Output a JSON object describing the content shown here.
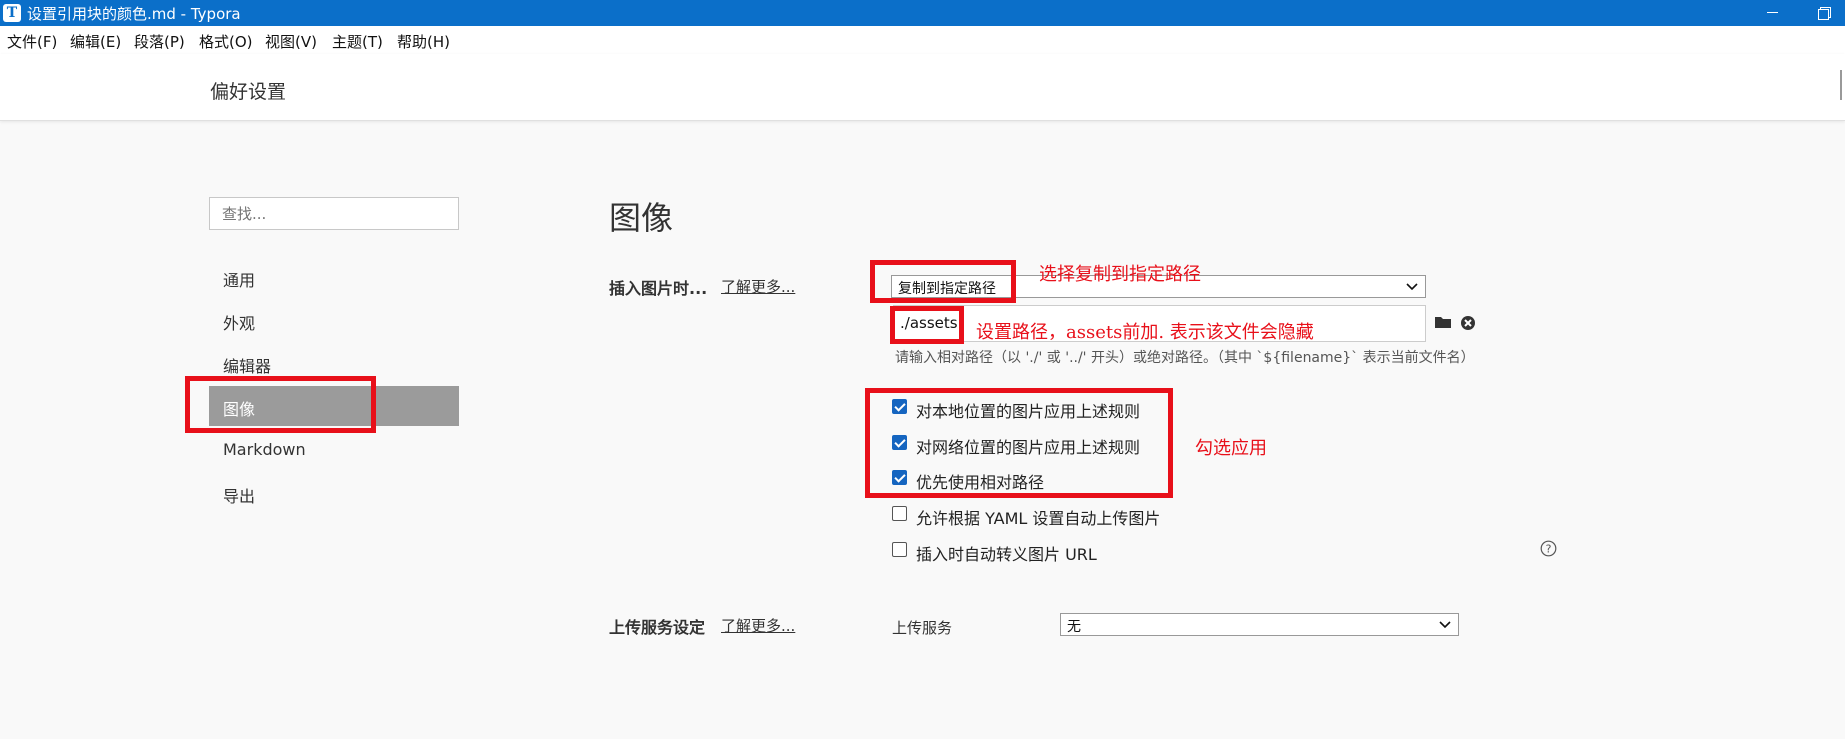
{
  "window": {
    "title": "设置引用块的颜色.md - Typora",
    "app_icon": "T"
  },
  "menu": [
    "文件(F)",
    "编辑(E)",
    "段落(P)",
    "格式(O)",
    "视图(V)",
    "主题(T)",
    "帮助(H)"
  ],
  "header": {
    "title": "偏好设置"
  },
  "sidebar": {
    "search_placeholder": "查找...",
    "items": [
      "通用",
      "外观",
      "编辑器",
      "图像",
      "Markdown",
      "导出"
    ],
    "active": "图像"
  },
  "main": {
    "section_title": "图像",
    "insert_image": {
      "label": "插入图片时...",
      "learn_more": "了解更多...",
      "action_selected": "复制到指定路径",
      "path_value": "./assets",
      "hint": "请输入相对路径（以 './' 或 '../' 开头）或绝对路径。（其中 `${filename}` 表示当前文件名）",
      "options": [
        {
          "label": "对本地位置的图片应用上述规则",
          "checked": true
        },
        {
          "label": "对网络位置的图片应用上述规则",
          "checked": true
        },
        {
          "label": "优先使用相对路径",
          "checked": true
        },
        {
          "label": "允许根据 YAML 设置自动上传图片",
          "checked": false
        },
        {
          "label": "插入时自动转义图片 URL",
          "checked": false
        }
      ]
    },
    "upload": {
      "label": "上传服务设定",
      "learn_more": "了解更多...",
      "service_label": "上传服务",
      "service_selected": "无"
    }
  },
  "annotations": {
    "copy_path": "选择复制到指定路径",
    "set_path": "设置路径，assets前加. 表示该文件会隐藏",
    "check_apply": "勾选应用"
  },
  "colors": {
    "titlebar": "#0b6fc9",
    "sidebar_active": "#9b9b9b",
    "checkbox": "#1565c0",
    "annotation": "#e8101a"
  }
}
